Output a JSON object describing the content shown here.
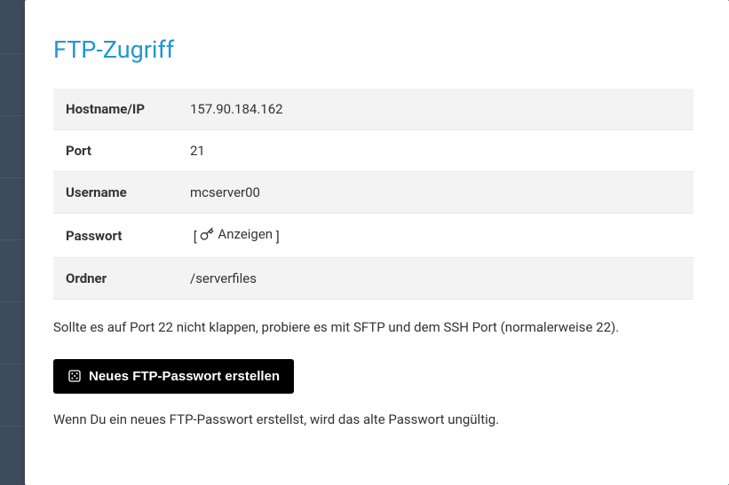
{
  "title": "FTP-Zugriff",
  "rows": {
    "hostname": {
      "label": "Hostname/IP",
      "value": "157.90.184.162"
    },
    "port": {
      "label": "Port",
      "value": "21"
    },
    "username": {
      "label": "Username",
      "value": "mcserver00"
    },
    "passwort": {
      "label": "Passwort",
      "show_text": "Anzeigen"
    },
    "ordner": {
      "label": "Ordner",
      "value": "/serverfiles"
    }
  },
  "hint": "Sollte es auf Port 22 nicht klappen, probiere es mit SFTP und dem SSH Port (normalerweise 22).",
  "button": {
    "label": "Neues FTP-Passwort erstellen"
  },
  "note": "Wenn Du ein neues FTP-Passwort erstellst, wird das alte Passwort ungültig."
}
